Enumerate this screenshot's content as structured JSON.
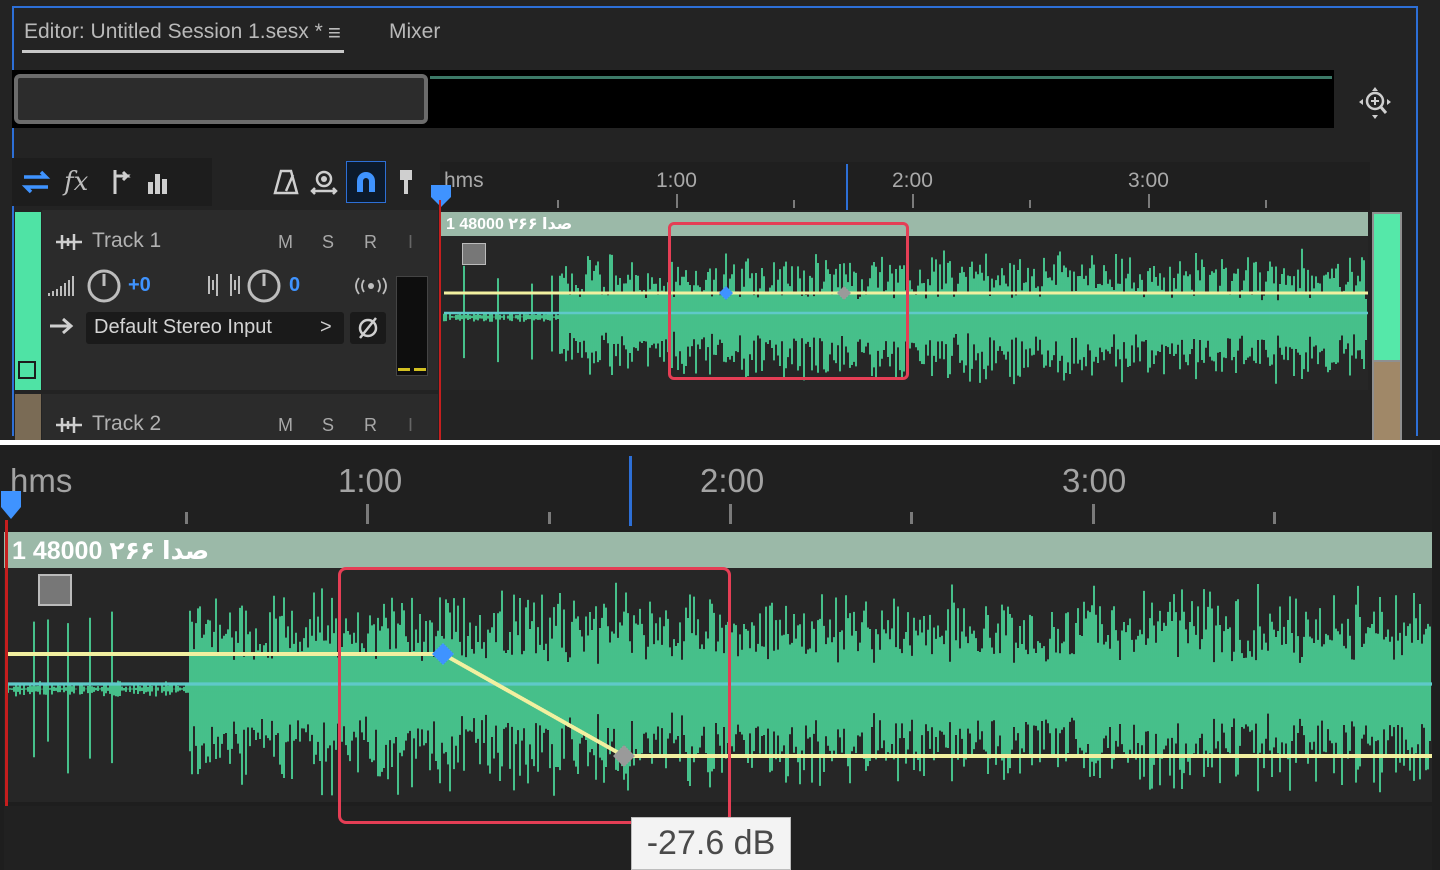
{
  "editor": {
    "tab_label": "Editor: Untitled Session 1.sesx *",
    "tab_menu_glyph": "≡",
    "mixer_tab_label": "Mixer"
  },
  "ruler": {
    "format_label": "hms",
    "marks": [
      "1:00",
      "2:00",
      "3:00"
    ]
  },
  "tracks": [
    {
      "name": "Track 1",
      "mute": "M",
      "solo": "S",
      "record": "R",
      "input_monitor": "I",
      "volume": "+0",
      "pan": "0",
      "input": "Default Stereo Input",
      "input_arrow": ">"
    },
    {
      "name": "Track 2",
      "mute": "M",
      "solo": "S",
      "record": "R",
      "input_monitor": "I"
    }
  ],
  "clip": {
    "title": "1 48000 ۲۶۶ صدا"
  },
  "tooltip": {
    "value": "-27.6 dB"
  },
  "colors": {
    "waveform": "#4ee6a4",
    "accent_blue": "#3f93ff",
    "highlight_red": "#e53e55",
    "envelope_yellow": "#f2f0a0",
    "pan_line": "#5fc9c9"
  },
  "icons": {
    "zoom": "zoom-to-fit-icon",
    "tools": [
      "swap-arrows-icon",
      "fx-icon",
      "sends-icon",
      "eq-bars-icon"
    ],
    "timeline_tools": [
      "metronome-icon",
      "loop-record-icon",
      "snap-magnet-icon",
      "marker-pin-icon"
    ]
  }
}
